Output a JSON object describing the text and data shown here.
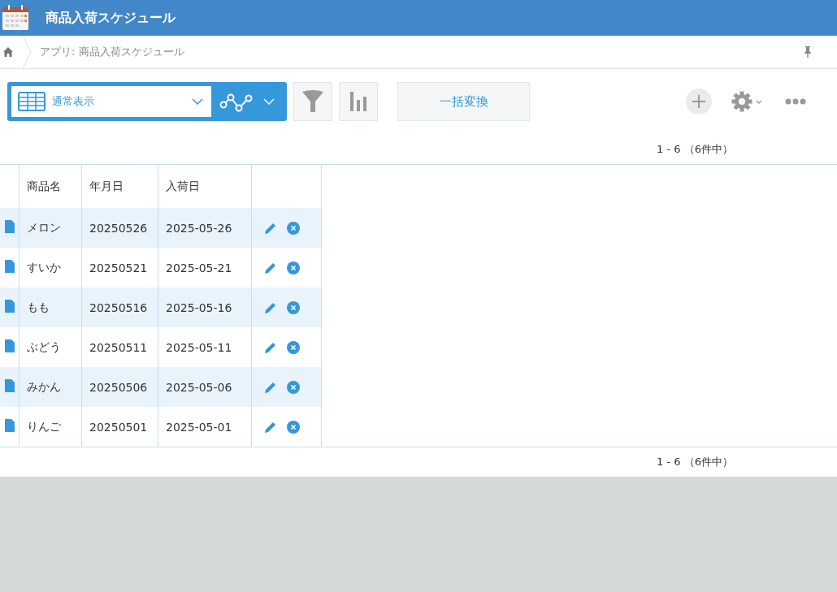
{
  "header": {
    "title": "商品入荷スケジュール"
  },
  "breadcrumb": {
    "items": [
      "アプリ: 商品入荷スケジュール"
    ]
  },
  "toolbar": {
    "view": "通常表示",
    "bulk_button": "一括変換"
  },
  "pager_top": "1 - 6 （6件中）",
  "table": {
    "columns": [
      "商品名",
      "年月日",
      "入荷日"
    ],
    "rows": [
      {
        "cells": [
          "メロン",
          "20250526",
          "2025-05-26"
        ]
      },
      {
        "cells": [
          "すいか",
          "20250521",
          "2025-05-21"
        ]
      },
      {
        "cells": [
          "もも",
          "20250516",
          "2025-05-16"
        ]
      },
      {
        "cells": [
          "ぶどう",
          "20250511",
          "2025-05-11"
        ]
      },
      {
        "cells": [
          "みかん",
          "20250506",
          "2025-05-06"
        ]
      },
      {
        "cells": [
          "りんご",
          "20250501",
          "2025-05-01"
        ]
      }
    ]
  },
  "pager_bottom": "1 - 6 （6件中）"
}
